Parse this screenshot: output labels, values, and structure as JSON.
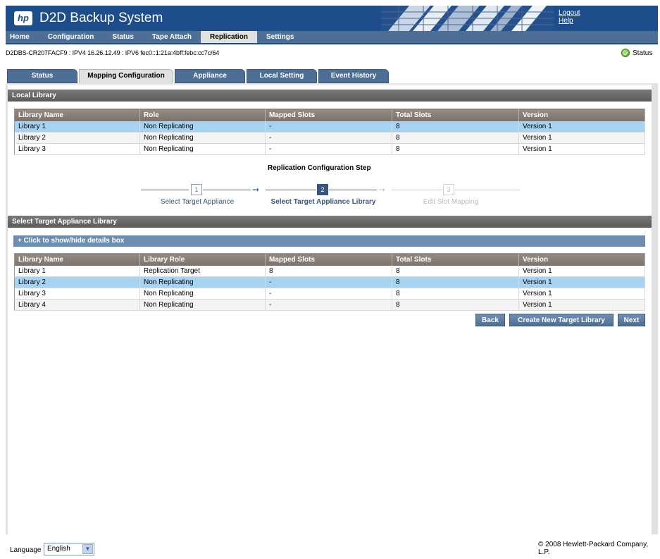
{
  "header": {
    "logo": "hp",
    "title": "D2D Backup System",
    "links": [
      "Logout",
      "Help"
    ],
    "color": "#1e4d8c"
  },
  "mainnav": {
    "items": [
      "Home",
      "Configuration",
      "Status",
      "Tape Attach",
      "Replication",
      "Settings"
    ],
    "active": "Replication"
  },
  "device_info": "D2DBS-CR207FACF9 : IPV4 16.26.12.49 : IPV6 fec0::1:21a:4bff:febc:cc7c/64",
  "status": {
    "label": "Status",
    "icon": "status-ok-icon"
  },
  "tabs": [
    "Status",
    "Mapping Configuration",
    "Appliance",
    "Local Setting",
    "Event History"
  ],
  "active_tab": "Mapping Configuration",
  "local_library": {
    "title": "Local Library",
    "columns": [
      "Library Name",
      "Role",
      "Mapped Slots",
      "Total Slots",
      "Version"
    ],
    "rows": [
      [
        "Library 1",
        "Non Replicating",
        "-",
        "8",
        "Version 1"
      ],
      [
        "Library 2",
        "Non Replicating",
        "-",
        "8",
        "Version 1"
      ],
      [
        "Library 3",
        "Non Replicating",
        "-",
        "8",
        "Version 1"
      ]
    ],
    "selected_row": 0
  },
  "steps": {
    "title": "Replication Configuration Step",
    "items": [
      {
        "num": "1",
        "label": "Select Target Appliance"
      },
      {
        "num": "2",
        "label": "Select Target Appliance Library"
      },
      {
        "num": "3",
        "label": "Edit Slot Mapping"
      }
    ],
    "current": 1
  },
  "target_library": {
    "title": "Select Target Appliance Library",
    "toggle": "+ Click to show/hide details box",
    "columns": [
      "Library Name",
      "Library Role",
      "Mapped Slots",
      "Total Slots",
      "Version"
    ],
    "rows": [
      [
        "Library 1",
        "Replication Target",
        "8",
        "8",
        "Version 1"
      ],
      [
        "Library 2",
        "Non Replicating",
        "-",
        "8",
        "Version 1"
      ],
      [
        "Library 3",
        "Non Replicating",
        "-",
        "8",
        "Version 1"
      ],
      [
        "Library 4",
        "Non Replicating",
        "-",
        "8",
        "Version 1"
      ]
    ],
    "selected_row": 1
  },
  "buttons": {
    "back": "Back",
    "create": "Create New Target Library",
    "next": "Next"
  },
  "footer": {
    "language_label": "Language",
    "language_value": "English",
    "copyright": "© 2008 Hewlett-Packard Company, L.P."
  }
}
